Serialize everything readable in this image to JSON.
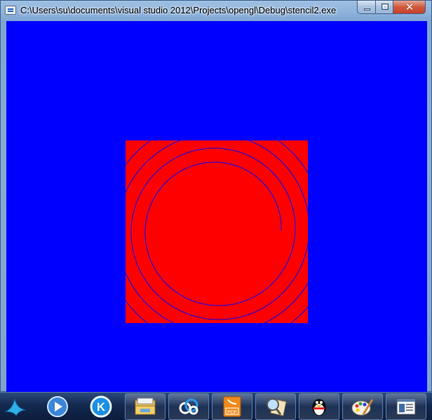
{
  "window": {
    "title": "C:\\Users\\su\\documents\\visual studio 2012\\Projects\\opengl\\Debug\\stencil2.exe",
    "controls": {
      "minimize_icon": "minimize-icon",
      "maximize_icon": "maximize-icon",
      "close_icon": "close-icon",
      "close_glyph": "✕"
    }
  },
  "canvas": {
    "background_color": "#0000ff",
    "square_color": "#ff0000",
    "spiral_color": "#0000ff"
  },
  "taskbar": {
    "items": [
      {
        "icon": "bird-app-icon"
      },
      {
        "icon": "media-player-icon"
      },
      {
        "icon": "k-app-icon"
      },
      {
        "icon": "file-explorer-icon"
      },
      {
        "icon": "cloud-drive-icon"
      },
      {
        "icon": "pdf-reader-icon"
      },
      {
        "icon": "image-viewer-icon"
      },
      {
        "icon": "qq-penguin-icon"
      },
      {
        "icon": "paint-icon"
      },
      {
        "icon": "application-window-icon"
      }
    ]
  }
}
